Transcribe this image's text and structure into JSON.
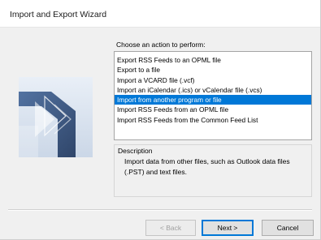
{
  "window": {
    "title": "Import and Export Wizard"
  },
  "main": {
    "prompt": "Choose an action to perform:",
    "actions": [
      {
        "label": "Export RSS Feeds to an OPML file",
        "selected": false
      },
      {
        "label": "Export to a file",
        "selected": false
      },
      {
        "label": "Import a VCARD file (.vcf)",
        "selected": false
      },
      {
        "label": "Import an iCalendar (.ics) or vCalendar file (.vcs)",
        "selected": false
      },
      {
        "label": "Import from another program or file",
        "selected": true
      },
      {
        "label": "Import RSS Feeds from an OPML file",
        "selected": false
      },
      {
        "label": "Import RSS Feeds from the Common Feed List",
        "selected": false
      }
    ],
    "description": {
      "label": "Description",
      "text": "Import data from other files, such as Outlook data files (.PST) and text files."
    }
  },
  "buttons": {
    "back": {
      "label": "< Back",
      "enabled": false
    },
    "next": {
      "label": "Next >",
      "enabled": true
    },
    "cancel": {
      "label": "Cancel",
      "enabled": true
    }
  },
  "colors": {
    "selection": "#0078d7",
    "illustration_dark": "#2f4f7e",
    "illustration_light": "#dce6f2"
  },
  "icons": {
    "illustration": "import-export-arrows-illustration"
  }
}
